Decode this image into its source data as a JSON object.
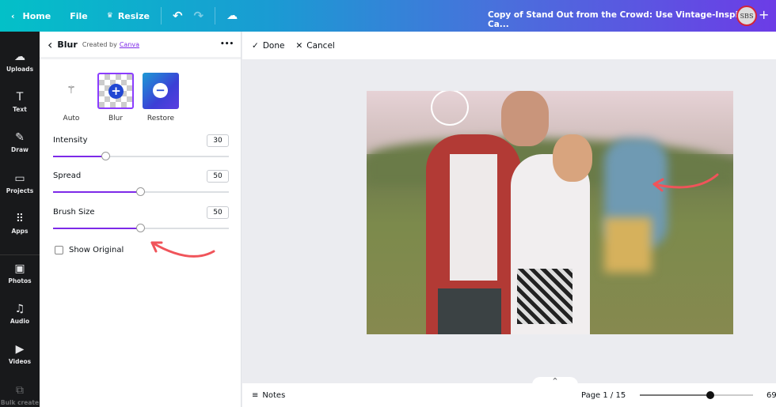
{
  "topbar": {
    "home": "Home",
    "file": "File",
    "resize": "Resize",
    "title": "Copy of Stand Out from the Crowd: Use Vintage-Inspired Ca...",
    "avatar": "SBS"
  },
  "sidebar": [
    {
      "label": "Uploads",
      "icon": "☁"
    },
    {
      "label": "Text",
      "icon": "T"
    },
    {
      "label": "Draw",
      "icon": "✎"
    },
    {
      "label": "Projects",
      "icon": "▭"
    },
    {
      "label": "Apps",
      "icon": "⠿"
    },
    {
      "label": "Photos",
      "icon": "▣"
    },
    {
      "label": "Audio",
      "icon": "♫"
    },
    {
      "label": "Videos",
      "icon": "▶"
    },
    {
      "label": "Bulk create",
      "icon": "⧉"
    }
  ],
  "panel": {
    "title": "Blur",
    "created_by": "Created by",
    "creator": "Canva",
    "more": "•••",
    "tools": [
      {
        "label": "Auto"
      },
      {
        "label": "Blur"
      },
      {
        "label": "Restore"
      }
    ],
    "sliders": [
      {
        "label": "Intensity",
        "value": "30"
      },
      {
        "label": "Spread",
        "value": "50"
      },
      {
        "label": "Brush Size",
        "value": "50"
      }
    ],
    "show_original": "Show Original"
  },
  "toolbar": {
    "done": "Done",
    "cancel": "Cancel"
  },
  "bottom": {
    "notes": "Notes",
    "page": "Page 1 / 15",
    "zoom": "69",
    "zoom_fraction": 0.62
  },
  "colors": {
    "accent": "#7d2ae8",
    "arrow": "#f0545a"
  }
}
